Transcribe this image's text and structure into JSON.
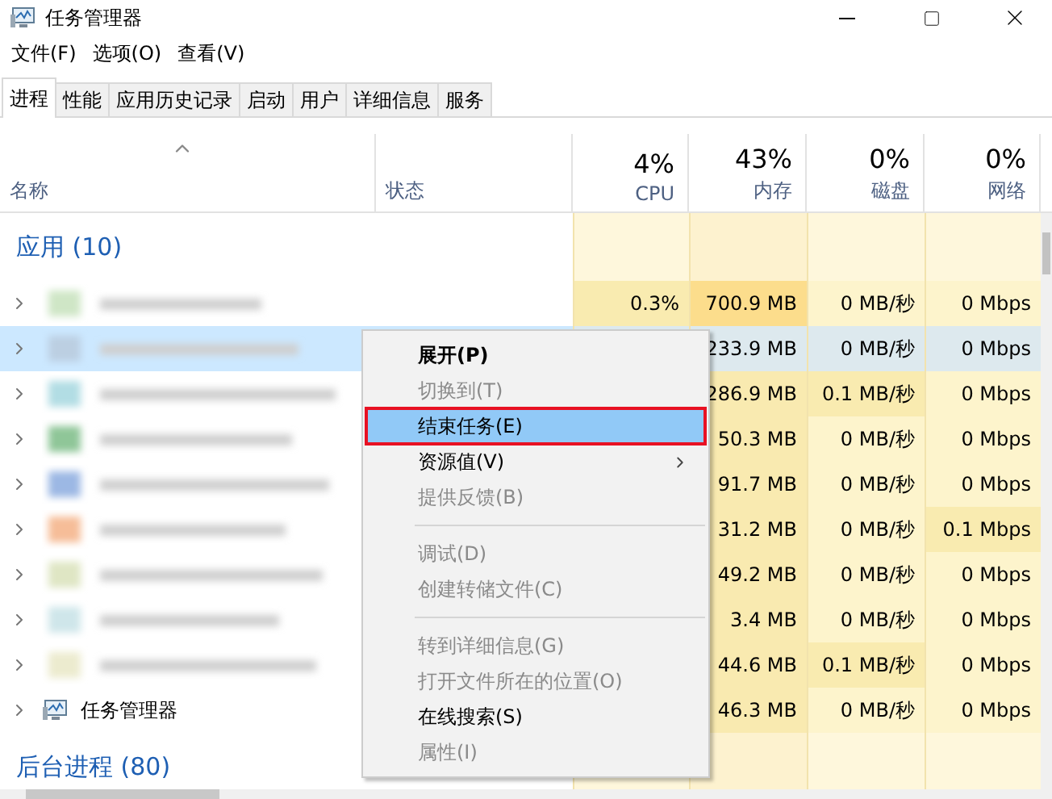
{
  "window": {
    "title": "任务管理器"
  },
  "menu_bar": [
    "文件(F)",
    "选项(O)",
    "查看(V)"
  ],
  "tabs": [
    {
      "label": "进程",
      "selected": true
    },
    {
      "label": "性能",
      "selected": false
    },
    {
      "label": "应用历史记录",
      "selected": false
    },
    {
      "label": "启动",
      "selected": false
    },
    {
      "label": "用户",
      "selected": false
    },
    {
      "label": "详细信息",
      "selected": false
    },
    {
      "label": "服务",
      "selected": false
    }
  ],
  "header": {
    "name": "名称",
    "status": "状态",
    "metrics": [
      {
        "percent": "4%",
        "label": "CPU"
      },
      {
        "percent": "43%",
        "label": "内存"
      },
      {
        "percent": "0%",
        "label": "磁盘"
      },
      {
        "percent": "0%",
        "label": "网络"
      }
    ]
  },
  "groups": [
    {
      "label": "应用 (10)",
      "rows": [
        {
          "kind": "blurred",
          "selected": false,
          "cpu": {
            "text": "0.3%",
            "hot": true
          },
          "cells": [
            {
              "text": "700.9 MB",
              "hot": true
            },
            {
              "text": "0 MB/秒",
              "hot": false
            },
            {
              "text": "0 Mbps",
              "hot": false
            }
          ]
        },
        {
          "kind": "blurred",
          "selected": true,
          "cells": [
            {
              "text": "233.9 MB",
              "hot": false
            },
            {
              "text": "0 MB/秒",
              "hot": false
            },
            {
              "text": "0 Mbps",
              "hot": false
            }
          ]
        },
        {
          "kind": "blurred",
          "selected": false,
          "cells": [
            {
              "text": "286.9 MB",
              "hot": false
            },
            {
              "text": "0.1 MB/秒",
              "hot": true
            },
            {
              "text": "0 Mbps",
              "hot": false
            }
          ]
        },
        {
          "kind": "blurred",
          "selected": false,
          "cells": [
            {
              "text": "50.3 MB",
              "hot": false
            },
            {
              "text": "0 MB/秒",
              "hot": false
            },
            {
              "text": "0 Mbps",
              "hot": false
            }
          ]
        },
        {
          "kind": "blurred",
          "selected": false,
          "cells": [
            {
              "text": "91.7 MB",
              "hot": false
            },
            {
              "text": "0 MB/秒",
              "hot": false
            },
            {
              "text": "0 Mbps",
              "hot": false
            }
          ]
        },
        {
          "kind": "blurred",
          "selected": false,
          "cells": [
            {
              "text": "31.2 MB",
              "hot": false
            },
            {
              "text": "0 MB/秒",
              "hot": false
            },
            {
              "text": "0.1 Mbps",
              "hot": true
            }
          ]
        },
        {
          "kind": "blurred",
          "selected": false,
          "cells": [
            {
              "text": "49.2 MB",
              "hot": false
            },
            {
              "text": "0 MB/秒",
              "hot": false
            },
            {
              "text": "0 Mbps",
              "hot": false
            }
          ]
        },
        {
          "kind": "blurred",
          "selected": false,
          "cells": [
            {
              "text": "3.4 MB",
              "hot": false
            },
            {
              "text": "0 MB/秒",
              "hot": false
            },
            {
              "text": "0 Mbps",
              "hot": false
            }
          ]
        },
        {
          "kind": "blurred",
          "selected": false,
          "cells": [
            {
              "text": "44.6 MB",
              "hot": false
            },
            {
              "text": "0.1 MB/秒",
              "hot": true
            },
            {
              "text": "0 Mbps",
              "hot": false
            }
          ]
        },
        {
          "kind": "app",
          "name": "任务管理器",
          "selected": false,
          "cells": [
            {
              "text": "46.3 MB",
              "hot": false
            },
            {
              "text": "0 MB/秒",
              "hot": false
            },
            {
              "text": "0 Mbps",
              "hot": false
            }
          ]
        }
      ]
    },
    {
      "label": "后台进程 (80)"
    }
  ],
  "context_menu": {
    "items": [
      {
        "kind": "item",
        "label": "展开(P)",
        "bold": true,
        "disabled": false,
        "selected": false
      },
      {
        "kind": "item",
        "label": "切换到(T)",
        "bold": false,
        "disabled": true,
        "selected": false
      },
      {
        "kind": "item",
        "label": "结束任务(E)",
        "bold": false,
        "disabled": false,
        "selected": true
      },
      {
        "kind": "submenu",
        "label": "资源值(V)",
        "bold": false,
        "disabled": false,
        "selected": false
      },
      {
        "kind": "item",
        "label": "提供反馈(B)",
        "bold": false,
        "disabled": true,
        "selected": false
      },
      {
        "kind": "separator"
      },
      {
        "kind": "item",
        "label": "调试(D)",
        "bold": false,
        "disabled": true,
        "selected": false
      },
      {
        "kind": "item",
        "label": "创建转储文件(C)",
        "bold": false,
        "disabled": true,
        "selected": false
      },
      {
        "kind": "separator"
      },
      {
        "kind": "item",
        "label": "转到详细信息(G)",
        "bold": false,
        "disabled": true,
        "selected": false
      },
      {
        "kind": "item",
        "label": "打开文件所在的位置(O)",
        "bold": false,
        "disabled": true,
        "selected": false
      },
      {
        "kind": "item",
        "label": "在线搜索(S)",
        "bold": false,
        "disabled": false,
        "selected": false
      },
      {
        "kind": "item",
        "label": "属性(I)",
        "bold": false,
        "disabled": true,
        "selected": false
      }
    ]
  }
}
